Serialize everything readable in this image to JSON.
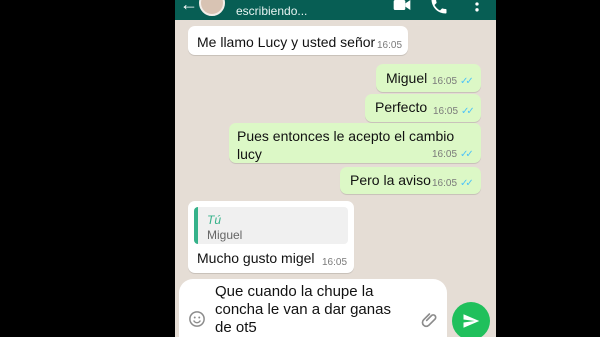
{
  "header": {
    "status": "escribiendo...",
    "icons": [
      "back-arrow-icon",
      "avatar",
      "video-call-icon",
      "phone-icon",
      "more-options-icon"
    ]
  },
  "messages": [
    {
      "dir": "in",
      "text": "Me llamo Lucy y usted señor",
      "time": "16:05"
    },
    {
      "dir": "out",
      "text": "Miguel",
      "time": "16:05"
    },
    {
      "dir": "out",
      "text": "Perfecto",
      "time": "16:05"
    },
    {
      "dir": "out",
      "text": "Pues entonces le acepto el cambio lucy",
      "time": "16:05"
    },
    {
      "dir": "out",
      "text": "Pero la aviso",
      "time": "16:05"
    },
    {
      "dir": "in",
      "quote_author": "Tú",
      "quote_text": "Miguel",
      "text": "Mucho gusto migel",
      "time": "16:05"
    }
  ],
  "composer": {
    "text": "Que cuando la chupe la\nconcha le van a dar ganas\nde ot5"
  },
  "colors": {
    "header": "#075e54",
    "chat_background": "#e5ddd5",
    "outgoing_bubble": "#dcf8c6",
    "incoming_bubble": "#ffffff",
    "read_ticks": "#4fc3f7",
    "send_button": "#20c05c"
  }
}
